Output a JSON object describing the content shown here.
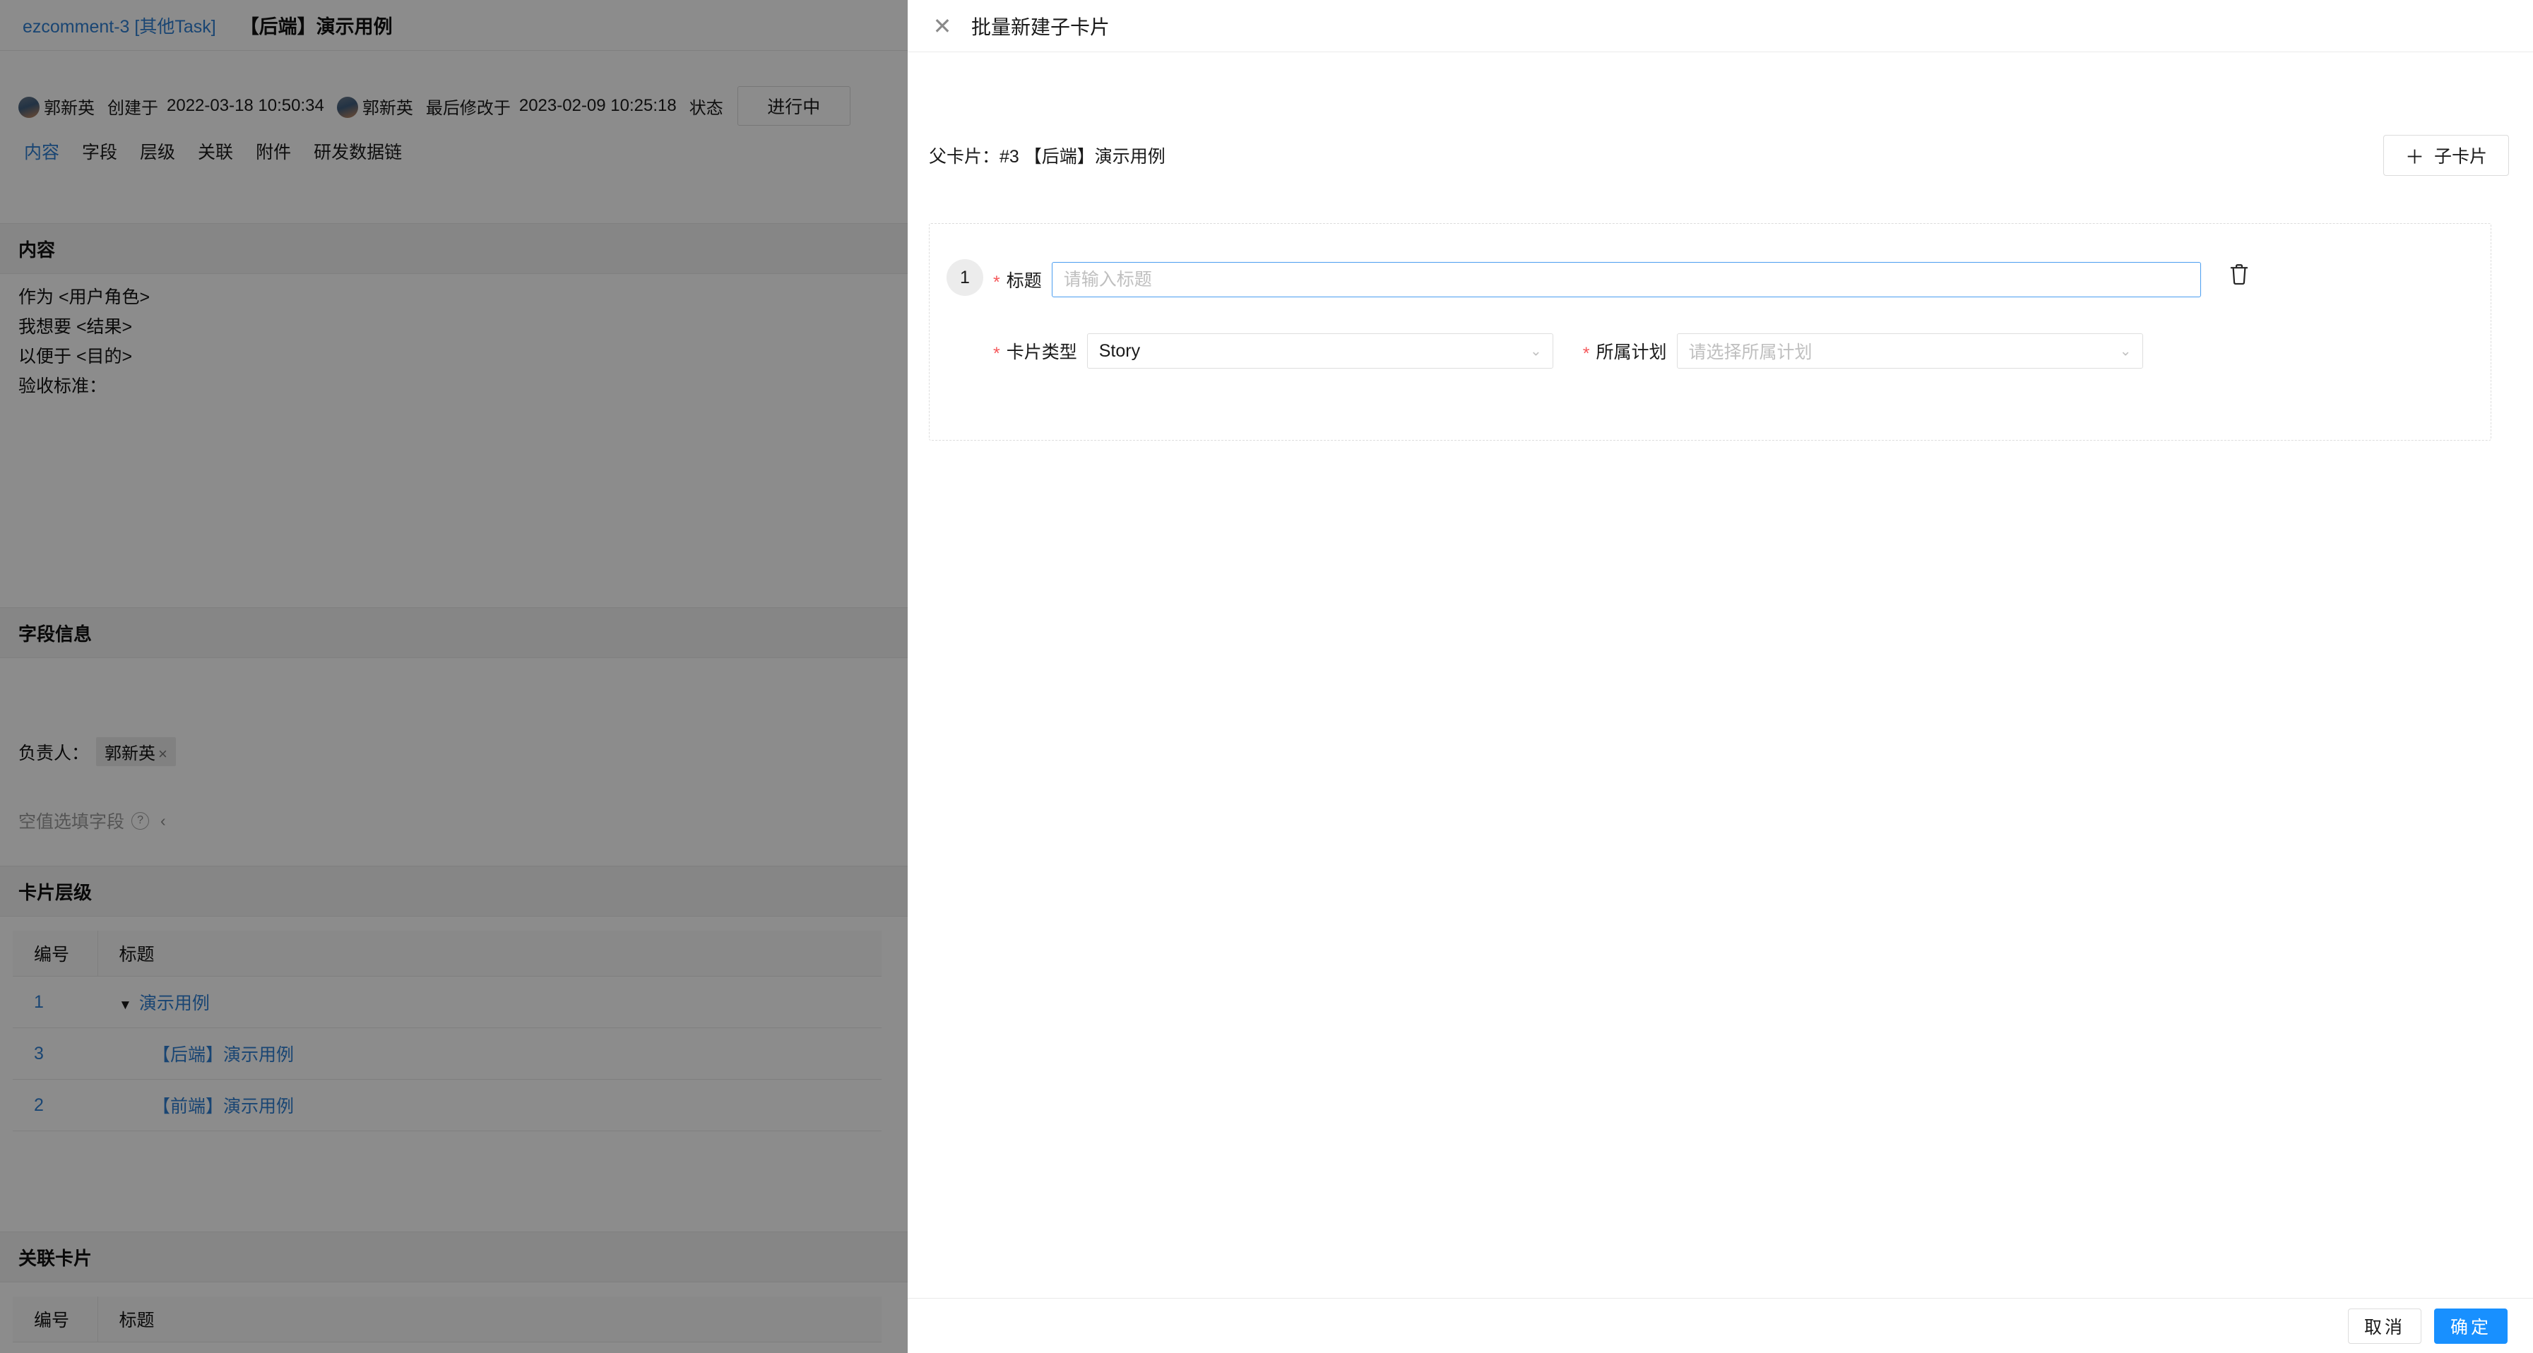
{
  "background": {
    "breadcrumb": {
      "key": "ezcomment-3 [其他Task]",
      "title": "【后端】演示用例"
    },
    "meta": {
      "created_by": "郭新英",
      "created_label": "创建于",
      "created_at": "2022-03-18 10:50:34",
      "modified_by": "郭新英",
      "modified_label": "最后修改于",
      "modified_at": "2023-02-09 10:25:18",
      "status_label": "状态",
      "status_value": "进行中"
    },
    "tabs": [
      {
        "label": "内容",
        "active": true
      },
      {
        "label": "字段",
        "active": false
      },
      {
        "label": "层级",
        "active": false
      },
      {
        "label": "关联",
        "active": false
      },
      {
        "label": "附件",
        "active": false
      },
      {
        "label": "研发数据链",
        "active": false
      }
    ],
    "sections": {
      "content_title": "内容",
      "content_lines": [
        "作为 <用户角色>",
        "我想要 <结果>",
        "以便于 <目的>",
        "验收标准："
      ],
      "fields_title": "字段信息",
      "owner_label": "负责人：",
      "owner_value": "郭新英",
      "owner_remove": "×",
      "empty_fields_label": "空值选填字段",
      "empty_fields_help": "?",
      "empty_fields_collapse": "‹",
      "hierarchy_title": "卡片层级",
      "relation_title": "关联卡片"
    },
    "hierarchy_table": {
      "columns": [
        "编号",
        "标题"
      ],
      "rows": [
        {
          "id": "1",
          "title": "演示用例",
          "indent": 0,
          "expander": "▼"
        },
        {
          "id": "3",
          "title": "【后端】演示用例",
          "indent": 1,
          "expander": ""
        },
        {
          "id": "2",
          "title": "【前端】演示用例",
          "indent": 1,
          "expander": ""
        }
      ]
    },
    "relation_table": {
      "columns": [
        "编号",
        "标题"
      ],
      "rows": []
    }
  },
  "drawer": {
    "close_icon": "✕",
    "title": "批量新建子卡片",
    "parent_label": "父卡片：#3 【后端】演示用例",
    "add_child_button": {
      "plus": "＋",
      "label": "子卡片"
    },
    "cards": [
      {
        "seq": "1",
        "title_field": {
          "required_mark": "*",
          "label": "标题",
          "value": "",
          "placeholder": "请输入标题"
        },
        "type_field": {
          "required_mark": "*",
          "label": "卡片类型",
          "value": "Story",
          "caret": "⌄"
        },
        "plan_field": {
          "required_mark": "*",
          "label": "所属计划",
          "value": "",
          "placeholder": "请选择所属计划",
          "caret": "⌄"
        },
        "delete_icon": "delete"
      }
    ],
    "footer": {
      "cancel_label": "取消",
      "confirm_label": "确定"
    }
  },
  "colors": {
    "primary": "#1890ff",
    "link": "#2f7fd1",
    "required": "#f5585b",
    "focus_border": "#4a9df0"
  }
}
